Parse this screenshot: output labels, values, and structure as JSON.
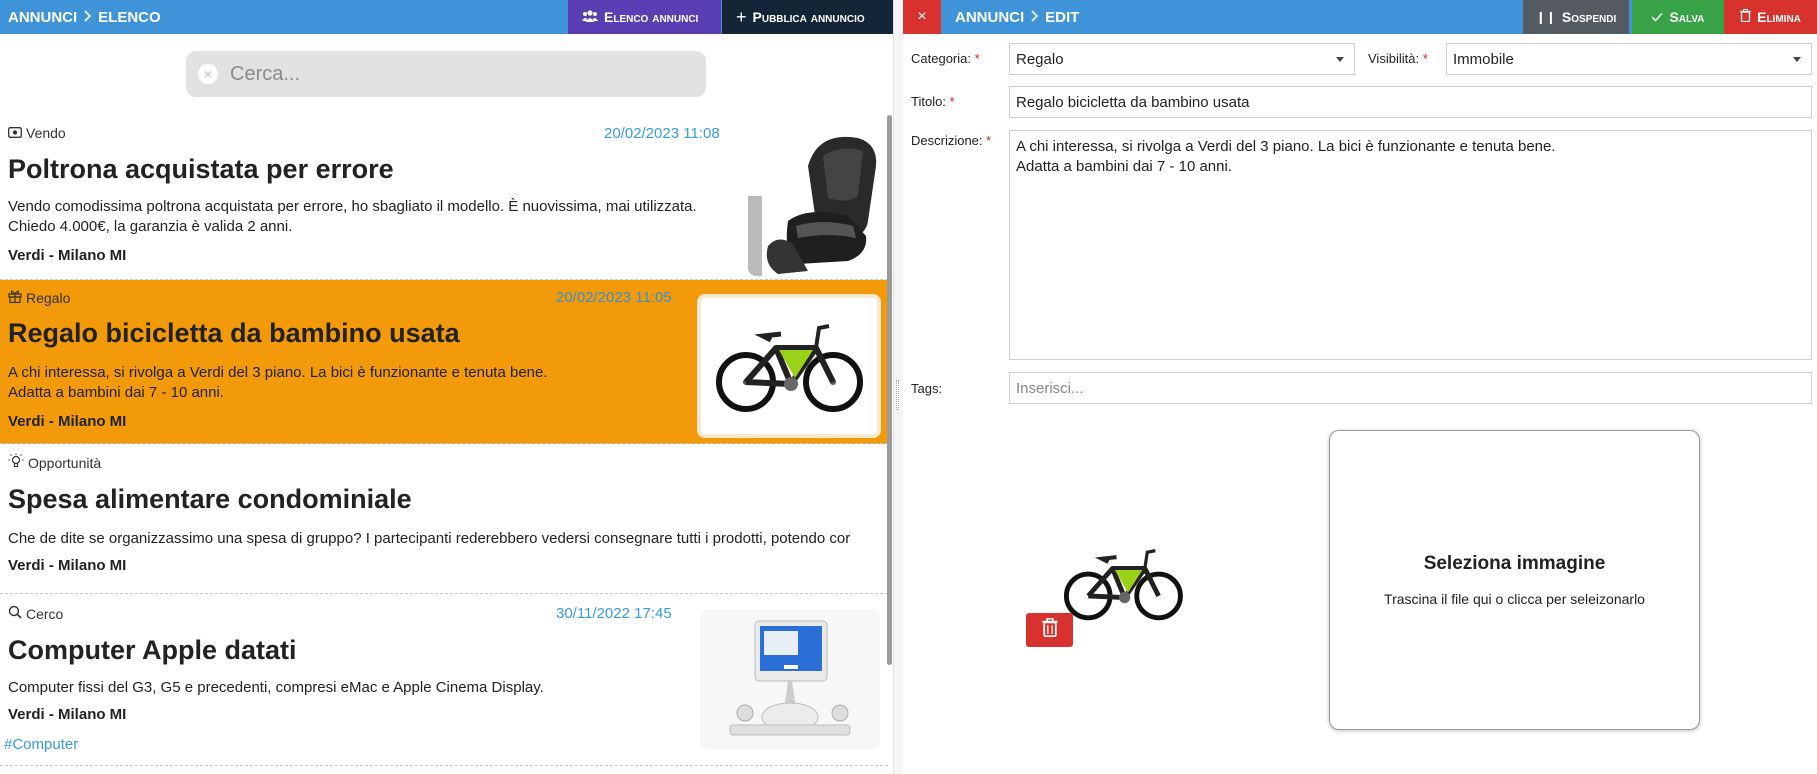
{
  "left": {
    "breadcrumb": {
      "root": "ANNUNCI",
      "current": "ELENCO"
    },
    "buttons": {
      "elenco": "Elenco annunci",
      "pubblica": "Pubblica annuncio"
    },
    "search": {
      "placeholder": "Cerca..."
    },
    "listings": [
      {
        "category": "Vendo",
        "category_icon": "banknote-icon",
        "date": "20/02/2023 11:08",
        "title": "Poltrona acquistata per errore",
        "description": "Vendo comodissima poltrona acquistata per errore, ho sbagliato il modello. È nuovissima, mai utilizzata.\nChiedo 4.000€, la garanzia è valida 2 anni.",
        "location": "Verdi - Milano MI",
        "image": "massage-chair-image"
      },
      {
        "category": "Regalo",
        "category_icon": "gift-icon",
        "date": "20/02/2023 11:05",
        "title": "Regalo bicicletta da bambino usata",
        "description": "A chi interessa, si rivolga a Verdi del 3 piano. La bici è funzionante e tenuta bene.\nAdatta a bambini dai 7 - 10 anni.",
        "location": "Verdi - Milano MI",
        "image": "bicycle-image",
        "selected": true
      },
      {
        "category": "Opportunità",
        "category_icon": "lightbulb-icon",
        "date": "",
        "title": "Spesa alimentare condominiale",
        "description": "Che de dite se organizzassimo una spesa di gruppo? I partecipanti rederebbero vedersi consegnare tutti i prodotti, potendo cor",
        "location": "Verdi - Milano MI",
        "image": ""
      },
      {
        "category": "Cerco",
        "category_icon": "search-icon",
        "date": "30/11/2022 17:45",
        "title": "Computer Apple datati",
        "description": "Computer fissi del G3, G5 e precedenti, compresi eMac e Apple Cinema Display.",
        "location": "Verdi - Milano MI",
        "tag": "#Computer",
        "image": "imac-image"
      }
    ],
    "colors": {
      "bar": "#3f93d8",
      "selected": "#f39a0a",
      "date": "#3a9bd9"
    }
  },
  "right": {
    "breadcrumb": {
      "root": "ANNUNCI",
      "current": "EDIT"
    },
    "buttons": {
      "close": "×",
      "sospendi": "Sospendi",
      "salva": "Salva",
      "elimina": "Elimina"
    },
    "form": {
      "categoria_label": "Categoria:",
      "categoria_value": "Regalo",
      "visibilita_label": "Visibilità:",
      "visibilita_value": "Immobile",
      "titolo_label": "Titolo:",
      "titolo_value": "Regalo bicicletta da bambino usata",
      "descrizione_label": "Descrizione:",
      "descrizione_value": "A chi interessa, si rivolga a Verdi del 3 piano. La bici è funzionante e tenuta bene.\nAdatta a bambini dai 7 - 10 anni.",
      "tags_label": "Tags:",
      "tags_placeholder": "Inserisci...",
      "required_mark": "*"
    },
    "dropzone": {
      "title": "Seleziona immagine",
      "subtitle": "Trascina il file qui o clicca per seleizonarlo"
    }
  }
}
